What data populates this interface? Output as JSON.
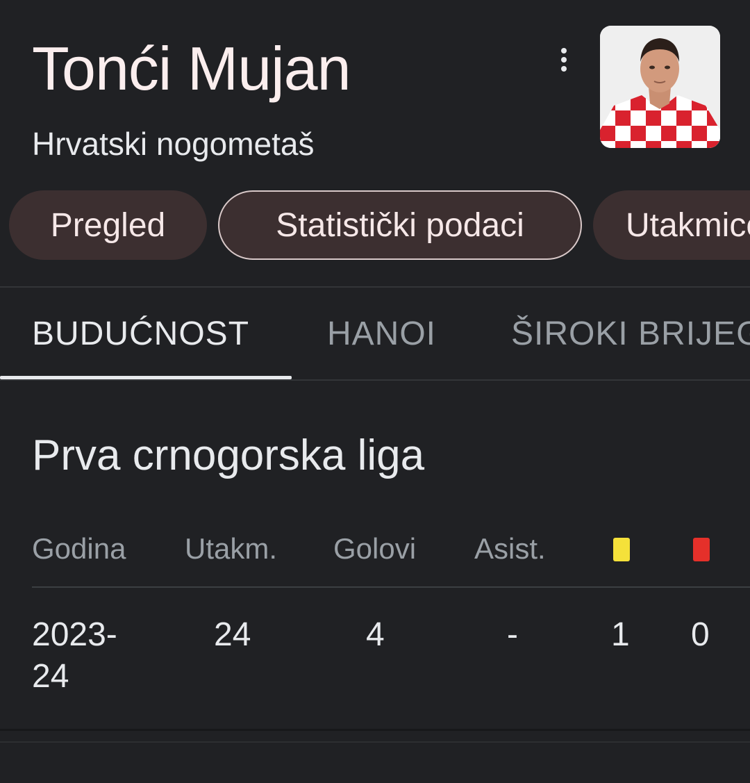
{
  "player": {
    "name": "Tonći Mujan",
    "subtitle": "Hrvatski nogometaš"
  },
  "icons": {
    "more": "more-vert-icon",
    "yellow_card": "yellow-card-icon",
    "red_card": "red-card-icon"
  },
  "chips": [
    {
      "label": "Pregled"
    },
    {
      "label": "Statistički podaci"
    },
    {
      "label": "Utakmice"
    }
  ],
  "club_tabs": [
    {
      "label": "BUDUĆNOST"
    },
    {
      "label": "HANOI"
    },
    {
      "label": "ŠIROKI BRIJEG"
    }
  ],
  "league": {
    "title": "Prva crnogorska liga",
    "columns": {
      "year": "Godina",
      "matches": "Utakm.",
      "goals": "Golovi",
      "assists": "Asist."
    },
    "rows": [
      {
        "year": "2023-24",
        "matches": "24",
        "goals": "4",
        "assists": "-",
        "yellow": "1",
        "red": "0"
      }
    ]
  },
  "colors": {
    "background": "#202124",
    "chip_bg": "#3c2f30",
    "yellow_card": "#f5e13a",
    "red_card": "#e5302a"
  }
}
